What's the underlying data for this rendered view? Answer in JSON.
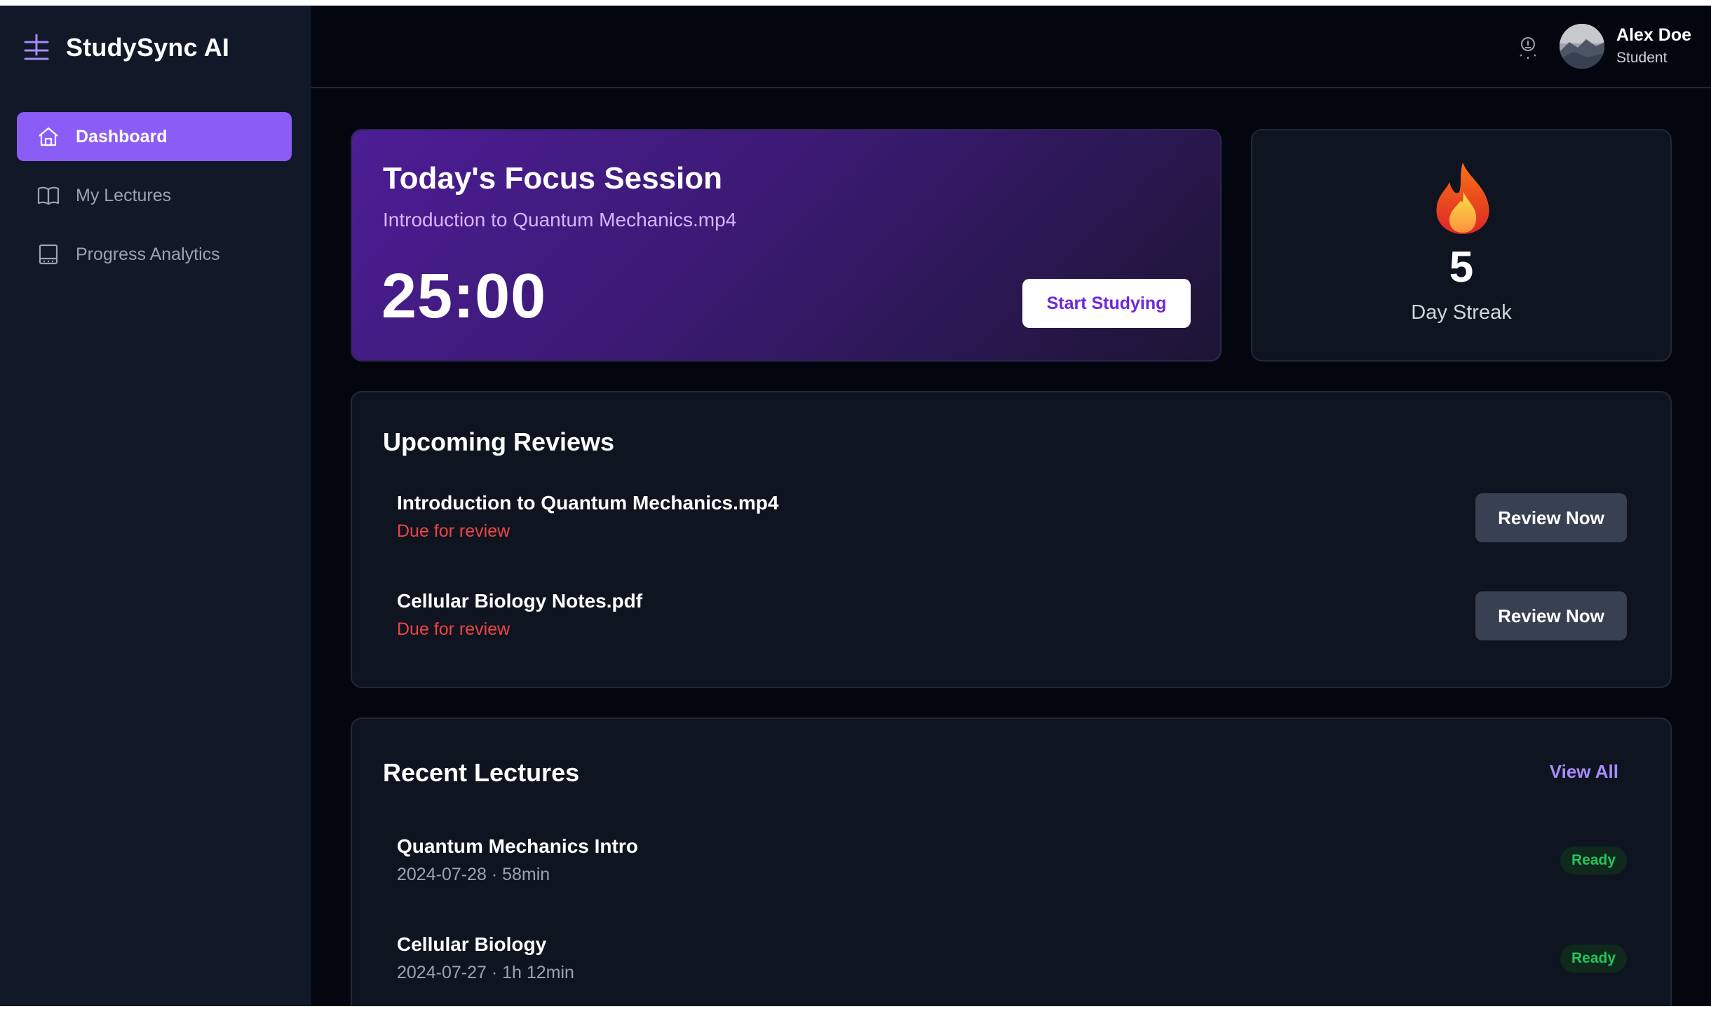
{
  "app": {
    "name": "StudySync AI"
  },
  "sidebar": {
    "items": [
      {
        "label": "Dashboard",
        "icon": "home-icon",
        "active": true
      },
      {
        "label": "My Lectures",
        "icon": "book-icon",
        "active": false
      },
      {
        "label": "Progress Analytics",
        "icon": "analytics-icon",
        "active": false
      }
    ]
  },
  "header": {
    "theme_icon": "lightbulb-icon",
    "user": {
      "name": "Alex Doe",
      "role": "Student"
    }
  },
  "focus": {
    "title": "Today's Focus Session",
    "file": "Introduction to Quantum Mechanics.mp4",
    "timer": "25:00",
    "button": "Start Studying"
  },
  "streak": {
    "icon": "fire-icon",
    "count": "5",
    "label": "Day Streak"
  },
  "reviews": {
    "title": "Upcoming Reviews",
    "items": [
      {
        "title": "Introduction to Quantum Mechanics.mp4",
        "status": "Due for review",
        "button": "Review Now"
      },
      {
        "title": "Cellular Biology Notes.pdf",
        "status": "Due for review",
        "button": "Review Now"
      }
    ]
  },
  "lectures": {
    "title": "Recent Lectures",
    "view_all": "View All",
    "items": [
      {
        "title": "Quantum Mechanics Intro",
        "meta": "2024-07-28 · 58min",
        "status": "Ready"
      },
      {
        "title": "Cellular Biology",
        "meta": "2024-07-27 · 1h 12min",
        "status": "Ready"
      }
    ]
  },
  "colors": {
    "accent": "#8b5cf6",
    "background": "#03060f",
    "sidebar": "#111827",
    "due": "#ef4444",
    "ready": "#22c55e"
  }
}
